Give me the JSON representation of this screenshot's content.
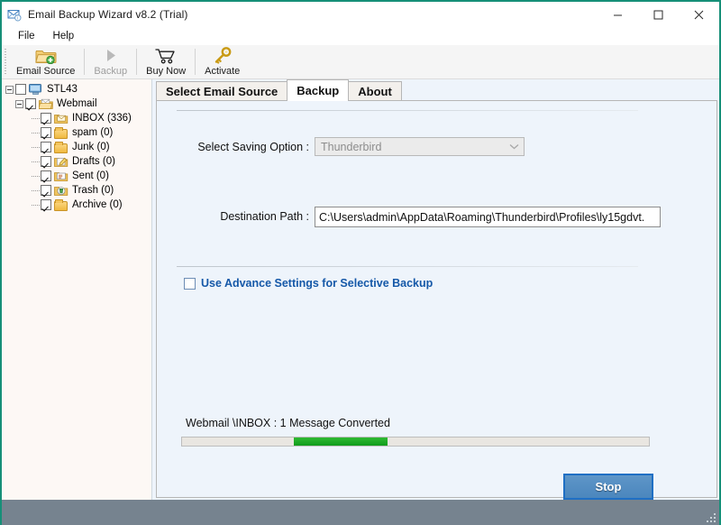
{
  "window": {
    "title": "Email Backup Wizard v8.2 (Trial)",
    "title_icon": "mail-envelope-icon",
    "accent_border": "#168f78",
    "controls": {
      "minimize": "minimize-icon",
      "maximize": "maximize-icon",
      "close": "close-icon"
    }
  },
  "menu": {
    "items": [
      {
        "label": "File"
      },
      {
        "label": "Help"
      }
    ]
  },
  "toolbar": {
    "buttons": [
      {
        "label": "Email Source",
        "icon": "folder-add-icon",
        "enabled": true
      },
      {
        "label": "Backup",
        "icon": "play-triangle-icon",
        "enabled": false
      },
      {
        "label": "Buy Now",
        "icon": "shopping-cart-icon",
        "enabled": true
      },
      {
        "label": "Activate",
        "icon": "key-icon",
        "enabled": true
      }
    ]
  },
  "sidebar": {
    "root": {
      "label": "STL43",
      "icon": "computer-icon",
      "expanded": true,
      "checked": false
    },
    "account": {
      "label": "Webmail",
      "icon": "mail-folder-icon",
      "expanded": true,
      "checked": true
    },
    "folders": [
      {
        "label": "INBOX (336)",
        "icon": "inbox-folder-icon",
        "checked": true
      },
      {
        "label": "spam (0)",
        "icon": "folder-icon",
        "checked": true
      },
      {
        "label": "Junk (0)",
        "icon": "folder-icon",
        "checked": true
      },
      {
        "label": "Drafts (0)",
        "icon": "drafts-folder-icon",
        "checked": true
      },
      {
        "label": "Sent (0)",
        "icon": "sent-folder-icon",
        "checked": true
      },
      {
        "label": "Trash (0)",
        "icon": "trash-folder-icon",
        "checked": true
      },
      {
        "label": "Archive (0)",
        "icon": "folder-icon",
        "checked": true
      }
    ]
  },
  "tabs": [
    {
      "label": "Select Email Source",
      "active": false
    },
    {
      "label": "Backup",
      "active": true
    },
    {
      "label": "About",
      "active": false
    }
  ],
  "backup_panel": {
    "saving_option_label": "Select Saving Option :",
    "saving_option_value": "Thunderbird",
    "saving_option_enabled": false,
    "saving_option_arrow": "chevron-down-icon",
    "destination_label": "Destination Path :",
    "destination_value": "C:\\Users\\admin\\AppData\\Roaming\\Thunderbird\\Profiles\\ly15gdvt.",
    "advance_settings_label": "Use Advance Settings for Selective Backup",
    "advance_settings_checked": false,
    "advance_settings_color": "#1558a8"
  },
  "progress": {
    "status_text": "Webmail \\INBOX : 1 Message Converted",
    "bar_style": "marquee",
    "chunk_color": "#18a524",
    "chunk_left_percent": 24,
    "chunk_width_percent": 20
  },
  "actions": {
    "stop_label": "Stop",
    "stop_color": "#4b86bd"
  },
  "status_bar": {
    "color": "#76838f",
    "grip": "resize-grip-icon"
  }
}
